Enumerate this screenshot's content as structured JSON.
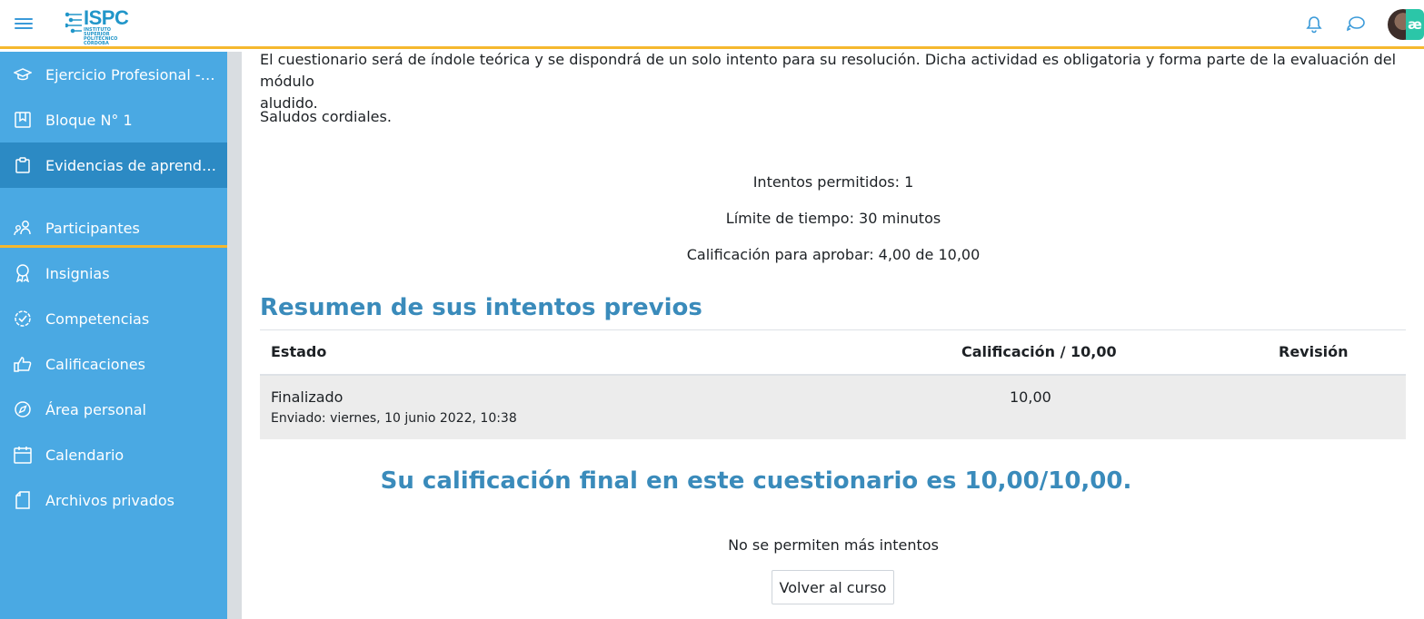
{
  "header": {
    "logo_text": "ISPC",
    "logo_subtitle": "INSTITUTO SUPERIOR POLITÉCNICO CÓRDOBA",
    "avatar_badge": "æ",
    "accent": "#f5b82e",
    "brand": "#2196c9"
  },
  "sidebar": {
    "bg": "#4aa9e3",
    "items": [
      {
        "label": "Ejercicio Profesional - T...",
        "icon": "graduation-cap-icon"
      },
      {
        "label": "Bloque N° 1",
        "icon": "bookmark-icon"
      },
      {
        "label": "Evidencias de aprendiz...",
        "icon": "clipboard-icon"
      },
      {
        "label": "Participantes",
        "icon": "users-icon"
      },
      {
        "label": "Insignias",
        "icon": "award-icon"
      },
      {
        "label": "Competencias",
        "icon": "check-badge-icon"
      },
      {
        "label": "Calificaciones",
        "icon": "thumbs-up-icon"
      },
      {
        "label": "Área personal",
        "icon": "compass-icon"
      },
      {
        "label": "Calendario",
        "icon": "calendar-icon"
      },
      {
        "label": "Archivos privados",
        "icon": "file-icon"
      }
    ]
  },
  "main": {
    "intro_line1": "El cuestionario será de índole teórica y se dispondrá de un solo intento para su resolución. Dicha actividad es obligatoria y forma parte de la evaluación del módulo",
    "intro_line2": "aludido.",
    "greeting": "Saludos cordiales.",
    "attempts_allowed": "Intentos permitidos: 1",
    "time_limit": "Límite de tiempo: 30 minutos",
    "pass_grade": "Calificación para aprobar: 4,00 de 10,00",
    "summary_heading": "Resumen de sus intentos previos",
    "table": {
      "headers": [
        "Estado",
        "Calificación / 10,00",
        "Revisión"
      ],
      "rows": [
        {
          "estado": "Finalizado",
          "enviado": "Enviado: viernes, 10 junio 2022, 10:38",
          "calificacion": "10,00",
          "revision": ""
        }
      ]
    },
    "final_grade": "Su calificación final en este cuestionario es 10,00/10,00.",
    "no_more_attempts": "No se permiten más intentos",
    "back_button": "Volver al curso"
  }
}
